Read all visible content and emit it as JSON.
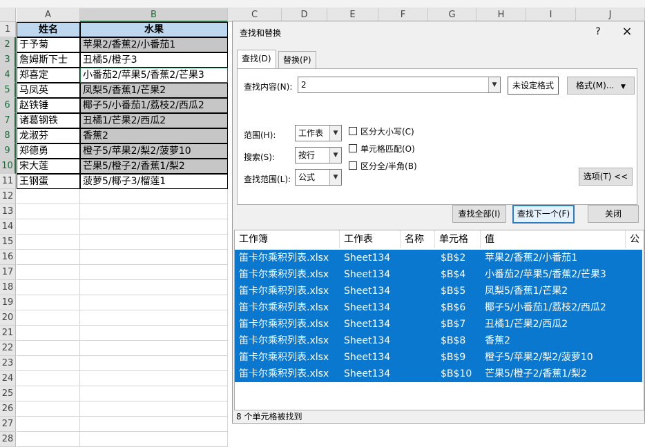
{
  "spreadsheet": {
    "columns": [
      "A",
      "B",
      "C",
      "D",
      "E",
      "F",
      "G",
      "H",
      "I",
      "J"
    ],
    "row_numbers": [
      "1",
      "2",
      "3",
      "4",
      "5",
      "6",
      "7",
      "8",
      "9",
      "10",
      "11",
      "12",
      "13",
      "14",
      "15",
      "16",
      "17",
      "18",
      "19",
      "20",
      "21",
      "22",
      "23",
      "24",
      "25",
      "26",
      "27",
      "28"
    ],
    "header": {
      "name": "姓名",
      "fruit": "水果"
    },
    "rows": [
      {
        "name": "于予菊",
        "fruit": "苹果2/香蕉2/小番茄1"
      },
      {
        "name": "詹姆斯下士",
        "fruit": "丑橘5/橙子3"
      },
      {
        "name": "郑喜定",
        "fruit": "小番茄2/苹果5/香蕉2/芒果3"
      },
      {
        "name": "马凤英",
        "fruit": "凤梨5/香蕉1/芒果2"
      },
      {
        "name": "赵铁锤",
        "fruit": "椰子5/小番茄1/荔枝2/西瓜2"
      },
      {
        "name": "诸葛钢铁",
        "fruit": "丑橘1/芒果2/西瓜2"
      },
      {
        "name": "龙淑芬",
        "fruit": "香蕉2"
      },
      {
        "name": "郑德勇",
        "fruit": "橙子5/苹果2/梨2/菠萝10"
      },
      {
        "name": "宋大莲",
        "fruit": "芒果5/橙子2/香蕉1/梨2"
      },
      {
        "name": "王钢蛋",
        "fruit": "菠萝5/椰子3/榴莲1"
      }
    ]
  },
  "dialog": {
    "title": "查找和替换",
    "help": "?",
    "close": "×",
    "tabs": [
      "查找(D)",
      "替换(P)"
    ],
    "find_label": "查找内容(N):",
    "find_value": "2",
    "format_preview": "未设定格式",
    "format_button": "格式(M)...",
    "within_label": "范围(H):",
    "within_value": "工作表",
    "search_label": "搜索(S):",
    "search_value": "按行",
    "lookin_label": "查找范围(L):",
    "lookin_value": "公式",
    "match_case": "区分大小写(C)",
    "match_cell": "单元格匹配(O)",
    "match_width": "区分全/半角(B)",
    "options_button": "选项(T) <<",
    "find_all": "查找全部(I)",
    "find_next": "查找下一个(F)",
    "close_button": "关闭",
    "results_headers": [
      "工作簿",
      "工作表",
      "名称",
      "单元格",
      "值",
      "公"
    ],
    "results": [
      {
        "book": "笛卡尔乘积列表.xlsx",
        "sheet": "Sheet134",
        "name": "",
        "cell": "$B$2",
        "value": "苹果2/香蕉2/小番茄1"
      },
      {
        "book": "笛卡尔乘积列表.xlsx",
        "sheet": "Sheet134",
        "name": "",
        "cell": "$B$4",
        "value": "小番茄2/苹果5/香蕉2/芒果3"
      },
      {
        "book": "笛卡尔乘积列表.xlsx",
        "sheet": "Sheet134",
        "name": "",
        "cell": "$B$5",
        "value": "凤梨5/香蕉1/芒果2"
      },
      {
        "book": "笛卡尔乘积列表.xlsx",
        "sheet": "Sheet134",
        "name": "",
        "cell": "$B$6",
        "value": "椰子5/小番茄1/荔枝2/西瓜2"
      },
      {
        "book": "笛卡尔乘积列表.xlsx",
        "sheet": "Sheet134",
        "name": "",
        "cell": "$B$7",
        "value": "丑橘1/芒果2/西瓜2"
      },
      {
        "book": "笛卡尔乘积列表.xlsx",
        "sheet": "Sheet134",
        "name": "",
        "cell": "$B$8",
        "value": "香蕉2"
      },
      {
        "book": "笛卡尔乘积列表.xlsx",
        "sheet": "Sheet134",
        "name": "",
        "cell": "$B$9",
        "value": "橙子5/苹果2/梨2/菠萝10"
      },
      {
        "book": "笛卡尔乘积列表.xlsx",
        "sheet": "Sheet134",
        "name": "",
        "cell": "$B$10",
        "value": "芒果5/橙子2/香蕉1/梨2"
      }
    ],
    "status": "8 个单元格被找到"
  }
}
